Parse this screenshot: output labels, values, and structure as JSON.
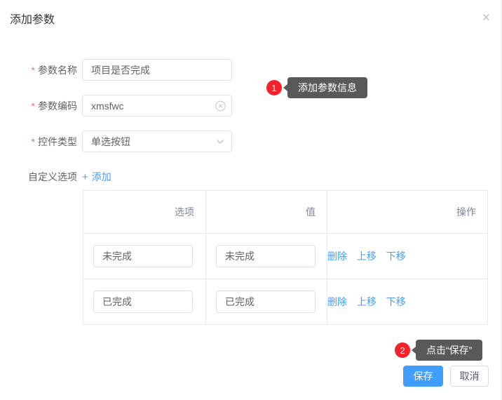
{
  "dialog": {
    "title": "添加参数",
    "required_marker": "*"
  },
  "icons": {
    "close": "×",
    "plus": "+"
  },
  "form": {
    "fields": [
      {
        "label": "参数名称",
        "value": "项目是否完成"
      },
      {
        "label": "参数编码",
        "value": "xmsfwc"
      },
      {
        "label": "控件类型",
        "value": "单选按钮"
      }
    ],
    "custom_options_label": "自定义选项",
    "add_label": "添加"
  },
  "table": {
    "headers": [
      "选项",
      "值",
      "操作"
    ],
    "rows": [
      {
        "option": "未完成",
        "value": "未完成",
        "actions": [
          "删除",
          "上移",
          "下移"
        ]
      },
      {
        "option": "已完成",
        "value": "已完成",
        "actions": [
          "删除",
          "上移",
          "下移"
        ]
      }
    ]
  },
  "annotations": [
    {
      "number": "1",
      "text": "添加参数信息"
    },
    {
      "number": "2",
      "text": "点击“保存”"
    }
  ],
  "footer": {
    "save_label": "保存",
    "cancel_label": "取消"
  },
  "colors": {
    "accent": "#409EFF",
    "badge_red": "#F5222D",
    "tooltip_bg": "#595959",
    "input_border": "#DCDFE6",
    "table_border": "#E8EAEC"
  }
}
